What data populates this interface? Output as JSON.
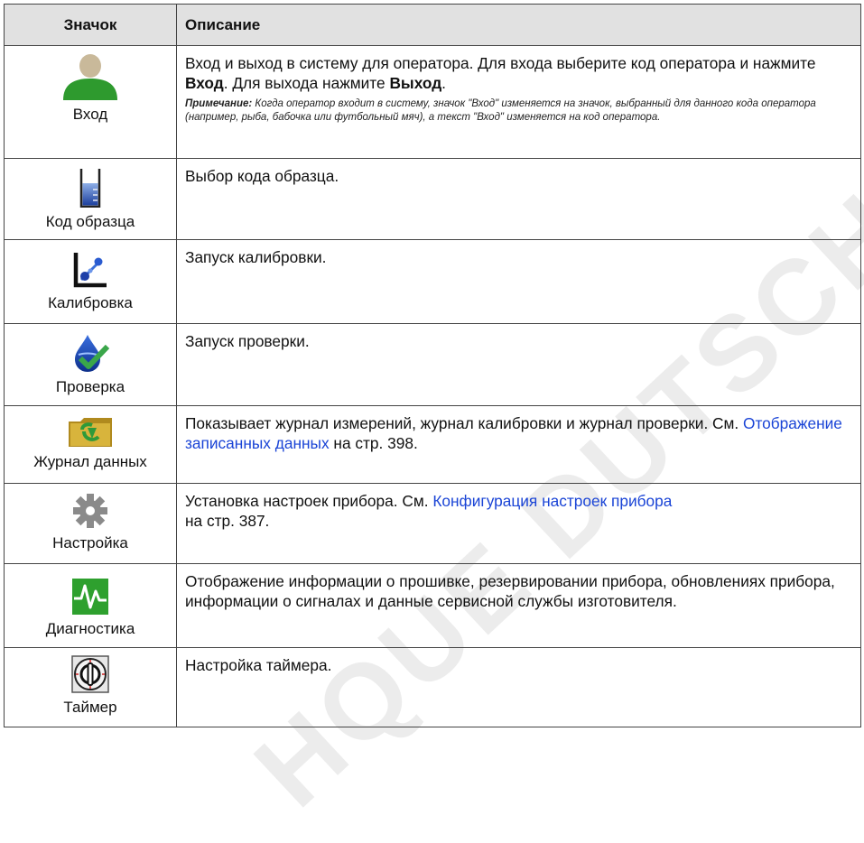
{
  "table": {
    "header": {
      "icon": "Значок",
      "description": "Описание"
    },
    "rows": [
      {
        "icon": "operator-login-icon",
        "name": "Вход",
        "desc": {
          "p1": "Вход и выход в систему для оператора. Для входа выберите код оператора и нажмите ",
          "b1": "Вход",
          "p2": ". Для выхода нажмите ",
          "b2": "Выход",
          "p3": "."
        },
        "note": {
          "label": "Примечание:",
          "text": " Когда оператор входит в систему, значок \"Вход\" изменяется на значок, выбранный для данного кода оператора (например, рыба, бабочка или футбольный мяч), а текст \"Вход\" изменяется на код оператора."
        }
      },
      {
        "icon": "sample-beaker-icon",
        "name": "Код образца",
        "desc": "Выбор кода образца."
      },
      {
        "icon": "calibration-graph-icon",
        "name": "Калибровка",
        "desc": "Запуск калибровки."
      },
      {
        "icon": "verification-drop-icon",
        "name": "Проверка",
        "desc": "Запуск проверки."
      },
      {
        "icon": "data-log-folder-icon",
        "name": "Журнал данных",
        "desc": {
          "p1": "Показывает журнал измерений, журнал калибровки и журнал проверки. См. ",
          "link": "Отображение записанных данных",
          "p2": " на стр. 398."
        }
      },
      {
        "icon": "settings-gear-icon",
        "name": "Настройка",
        "desc": {
          "p1": "Установка настроек прибора. См. ",
          "link": "Конфигурация настроек прибора",
          "p2": "на стр. 387."
        }
      },
      {
        "icon": "diagnostics-waveform-icon",
        "name": "Диагностика",
        "desc": "Отображение информации о прошивке, резервировании прибора, обновлениях прибора, информации о сигналах и данные сервисной службы изготовителя."
      },
      {
        "icon": "timer-clock-icon",
        "name": "Таймер",
        "desc": "Настройка таймера."
      }
    ]
  },
  "watermark": "HQUE DUTSCHER SAS",
  "colors": {
    "header_bg": "#e1e1e1",
    "link": "#1a44d6",
    "login_icon_green": "#2e9a2e",
    "diagnostics_green": "#2ea02e",
    "watermark": "#ececec"
  }
}
